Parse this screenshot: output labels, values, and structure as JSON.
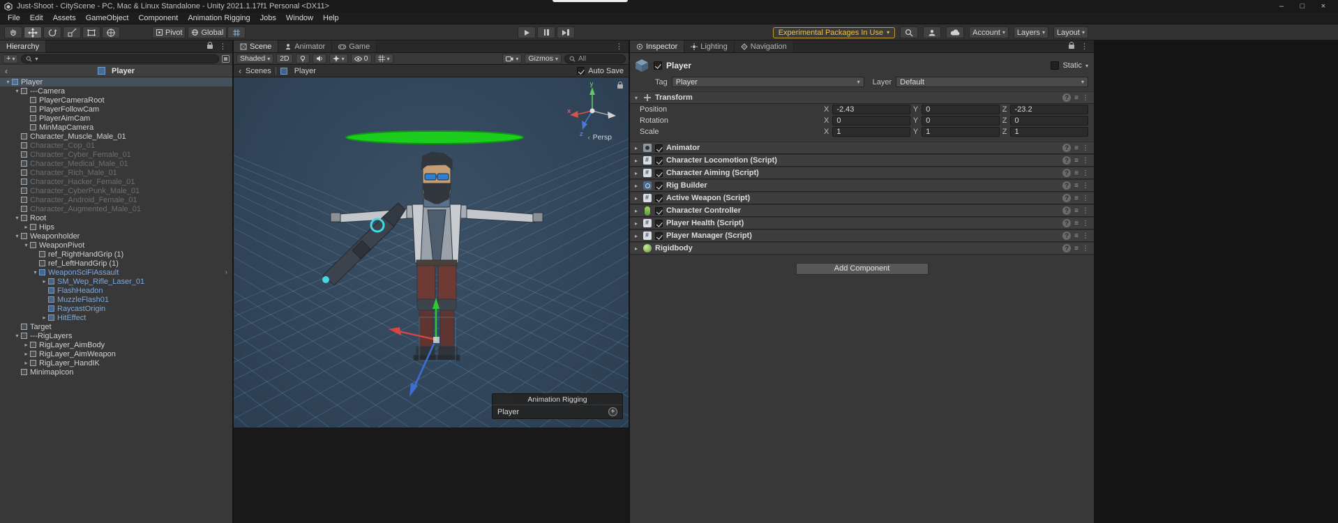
{
  "window": {
    "title": "Just-Shoot - CityScene - PC, Mac & Linux Standalone - Unity 2021.1.17f1 Personal <DX11>",
    "controls": {
      "minimize": "–",
      "maximize": "□",
      "close": "×"
    }
  },
  "menubar": {
    "items": [
      "File",
      "Edit",
      "Assets",
      "GameObject",
      "Component",
      "Animation Rigging",
      "Jobs",
      "Window",
      "Help"
    ]
  },
  "toolbar": {
    "pivot_label": "Pivot",
    "global_label": "Global",
    "experimental_label": "Experimental Packages In Use",
    "account_label": "Account",
    "layers_label": "Layers",
    "layout_label": "Layout",
    "accent_color": "#eec045"
  },
  "hierarchy": {
    "tab_label": "Hierarchy",
    "scene_header": "Player",
    "rows": [
      {
        "label": "Player",
        "indent": 0,
        "arrow": "down",
        "icon": "prefab",
        "selected": true
      },
      {
        "label": "---Camera",
        "indent": 1,
        "arrow": "down",
        "icon": "cube"
      },
      {
        "label": "PlayerCameraRoot",
        "indent": 2,
        "arrow": "",
        "icon": "cube"
      },
      {
        "label": "PlayerFollowCam",
        "indent": 2,
        "arrow": "",
        "icon": "cube"
      },
      {
        "label": "PlayerAimCam",
        "indent": 2,
        "arrow": "",
        "icon": "cube"
      },
      {
        "label": "MinMapCamera",
        "indent": 2,
        "arrow": "",
        "icon": "cube"
      },
      {
        "label": "Character_Muscle_Male_01",
        "indent": 1,
        "arrow": "",
        "icon": "cube"
      },
      {
        "label": "Character_Cop_01",
        "indent": 1,
        "arrow": "",
        "icon": "cube",
        "disabled": true
      },
      {
        "label": "Character_Cyber_Female_01",
        "indent": 1,
        "arrow": "",
        "icon": "cube",
        "disabled": true
      },
      {
        "label": "Character_Medical_Male_01",
        "indent": 1,
        "arrow": "",
        "icon": "cube",
        "disabled": true
      },
      {
        "label": "Character_Rich_Male_01",
        "indent": 1,
        "arrow": "",
        "icon": "cube",
        "disabled": true
      },
      {
        "label": "Character_Hacker_Female_01",
        "indent": 1,
        "arrow": "",
        "icon": "cube",
        "disabled": true
      },
      {
        "label": "Character_CyberPunk_Male_01",
        "indent": 1,
        "arrow": "",
        "icon": "cube",
        "disabled": true
      },
      {
        "label": "Character_Android_Female_01",
        "indent": 1,
        "arrow": "",
        "icon": "cube",
        "disabled": true
      },
      {
        "label": "Character_Augmented_Male_01",
        "indent": 1,
        "arrow": "",
        "icon": "cube",
        "disabled": true
      },
      {
        "label": "Root",
        "indent": 1,
        "arrow": "down",
        "icon": "cube"
      },
      {
        "label": "Hips",
        "indent": 2,
        "arrow": "right",
        "icon": "cube"
      },
      {
        "label": "Weaponholder",
        "indent": 1,
        "arrow": "down",
        "icon": "cube"
      },
      {
        "label": "WeaponPivot",
        "indent": 2,
        "arrow": "down",
        "icon": "cube"
      },
      {
        "label": "ref_RightHandGrip (1)",
        "indent": 3,
        "arrow": "",
        "icon": "cube"
      },
      {
        "label": "ref_LeftHandGrip (1)",
        "indent": 3,
        "arrow": "",
        "icon": "cube"
      },
      {
        "label": "WeaponSciFiAssault",
        "indent": 3,
        "arrow": "down",
        "icon": "prefab",
        "blue": true,
        "open_arrow": true
      },
      {
        "label": "SM_Wep_Rifle_Laser_01",
        "indent": 4,
        "arrow": "right",
        "icon": "prefab",
        "blue": true
      },
      {
        "label": "FlashHeadon",
        "indent": 4,
        "arrow": "",
        "icon": "prefab",
        "blue": true
      },
      {
        "label": "MuzzleFlash01",
        "indent": 4,
        "arrow": "",
        "icon": "prefab",
        "blue": true
      },
      {
        "label": "RaycastOrigin",
        "indent": 4,
        "arrow": "",
        "icon": "prefab",
        "blue": true
      },
      {
        "label": "HitEffect",
        "indent": 4,
        "arrow": "right",
        "icon": "prefab",
        "blue": true
      },
      {
        "label": "Target",
        "indent": 1,
        "arrow": "",
        "icon": "cube"
      },
      {
        "label": "---RigLayers",
        "indent": 1,
        "arrow": "down",
        "icon": "cube"
      },
      {
        "label": "RigLayer_AimBody",
        "indent": 2,
        "arrow": "right",
        "icon": "cube"
      },
      {
        "label": "RigLayer_AimWeapon",
        "indent": 2,
        "arrow": "right",
        "icon": "cube"
      },
      {
        "label": "RigLayer_HandIK",
        "indent": 2,
        "arrow": "right",
        "icon": "cube"
      },
      {
        "label": "MinimapIcon",
        "indent": 1,
        "arrow": "",
        "icon": "cube"
      }
    ]
  },
  "scene": {
    "tabs": [
      {
        "label": "Scene",
        "active": true
      },
      {
        "label": "Animator",
        "active": false
      },
      {
        "label": "Game",
        "active": false
      }
    ],
    "toolbar": {
      "shaded_label": "Shaded",
      "mode_2d": "2D",
      "hidden_count": "0",
      "gizmos_label": "Gizmos",
      "search_value": "All"
    },
    "breadcrumb": {
      "root": "Scenes",
      "current": "Player"
    },
    "autosave_label": "Auto Save",
    "viewport": {
      "persp_label": "Persp",
      "axis_labels": {
        "x": "x",
        "y": "y",
        "z": "z"
      }
    },
    "overlay": {
      "title": "Animation Rigging",
      "item_label": "Player"
    }
  },
  "inspector": {
    "tabs": [
      {
        "label": "Inspector",
        "active": true
      },
      {
        "label": "Lighting",
        "active": false
      },
      {
        "label": "Navigation",
        "active": false
      }
    ],
    "header": {
      "name": "Player",
      "static_label": "Static",
      "tag_label": "Tag",
      "tag_value": "Player",
      "layer_label": "Layer",
      "layer_value": "Default"
    },
    "transform": {
      "title": "Transform",
      "axis_labels": [
        "X",
        "Y",
        "Z"
      ],
      "rows": [
        {
          "label": "Position",
          "values": [
            "-2.43",
            "0",
            "-23.2"
          ]
        },
        {
          "label": "Rotation",
          "values": [
            "0",
            "0",
            "0"
          ]
        },
        {
          "label": "Scale",
          "values": [
            "1",
            "1",
            "1"
          ]
        }
      ]
    },
    "components": [
      {
        "name": "Animator",
        "icon": "animator",
        "checkbox": true
      },
      {
        "name": "Character Locomotion (Script)",
        "icon": "script",
        "checkbox": true
      },
      {
        "name": "Character Aiming (Script)",
        "icon": "script",
        "checkbox": true
      },
      {
        "name": "Rig Builder",
        "icon": "rig",
        "checkbox": true
      },
      {
        "name": "Active Weapon (Script)",
        "icon": "script",
        "checkbox": true
      },
      {
        "name": "Character Controller",
        "icon": "capsule",
        "checkbox": true
      },
      {
        "name": "Player Health (Script)",
        "icon": "script",
        "checkbox": true
      },
      {
        "name": "Player Manager (Script)",
        "icon": "script",
        "checkbox": true
      },
      {
        "name": "Rigidbody",
        "icon": "rigidbody",
        "checkbox": false
      }
    ],
    "add_component_label": "Add Component"
  }
}
